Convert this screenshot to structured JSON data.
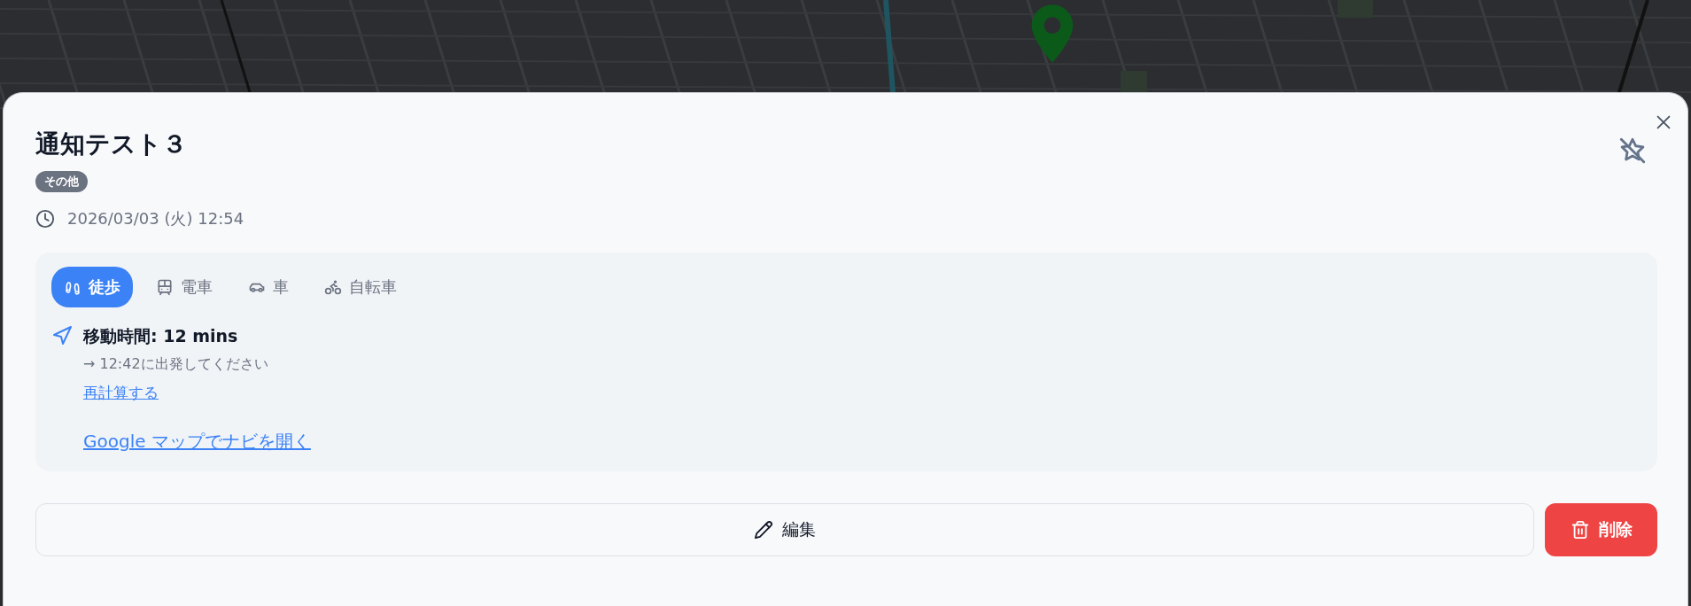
{
  "event": {
    "title": "通知テスト３",
    "category": "その他",
    "datetime": "2026/03/03 (火) 12:54",
    "pinned": false
  },
  "modes": [
    {
      "kind": "walk",
      "label": "徒歩",
      "selected": true
    },
    {
      "kind": "train",
      "label": "電車",
      "selected": false
    },
    {
      "kind": "car",
      "label": "車",
      "selected": false
    },
    {
      "kind": "bike",
      "label": "自転車",
      "selected": false
    }
  ],
  "route": {
    "travel_time": "移動時間: 12 mins",
    "departure": "→ 12:42に出発してください",
    "recalculate": "再計算する",
    "open_maps": "Google マップでナビを開く"
  },
  "buttons": [
    {
      "kind": "edit",
      "label": "編集"
    },
    {
      "kind": "delete",
      "label": "削除"
    }
  ]
}
